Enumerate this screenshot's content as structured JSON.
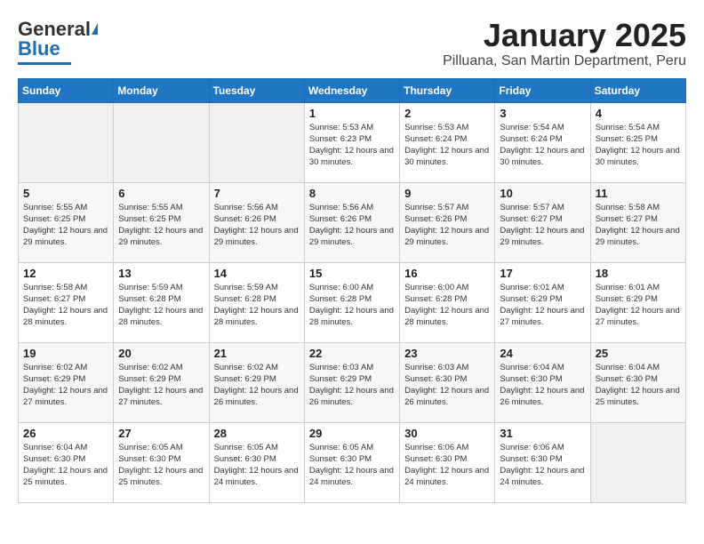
{
  "header": {
    "logo_general": "General",
    "logo_blue": "Blue",
    "title": "January 2025",
    "subtitle": "Pilluana, San Martin Department, Peru"
  },
  "days_of_week": [
    "Sunday",
    "Monday",
    "Tuesday",
    "Wednesday",
    "Thursday",
    "Friday",
    "Saturday"
  ],
  "weeks": [
    [
      {
        "day": "",
        "sunrise": "",
        "sunset": "",
        "daylight": ""
      },
      {
        "day": "",
        "sunrise": "",
        "sunset": "",
        "daylight": ""
      },
      {
        "day": "",
        "sunrise": "",
        "sunset": "",
        "daylight": ""
      },
      {
        "day": "1",
        "sunrise": "Sunrise: 5:53 AM",
        "sunset": "Sunset: 6:23 PM",
        "daylight": "Daylight: 12 hours and 30 minutes."
      },
      {
        "day": "2",
        "sunrise": "Sunrise: 5:53 AM",
        "sunset": "Sunset: 6:24 PM",
        "daylight": "Daylight: 12 hours and 30 minutes."
      },
      {
        "day": "3",
        "sunrise": "Sunrise: 5:54 AM",
        "sunset": "Sunset: 6:24 PM",
        "daylight": "Daylight: 12 hours and 30 minutes."
      },
      {
        "day": "4",
        "sunrise": "Sunrise: 5:54 AM",
        "sunset": "Sunset: 6:25 PM",
        "daylight": "Daylight: 12 hours and 30 minutes."
      }
    ],
    [
      {
        "day": "5",
        "sunrise": "Sunrise: 5:55 AM",
        "sunset": "Sunset: 6:25 PM",
        "daylight": "Daylight: 12 hours and 29 minutes."
      },
      {
        "day": "6",
        "sunrise": "Sunrise: 5:55 AM",
        "sunset": "Sunset: 6:25 PM",
        "daylight": "Daylight: 12 hours and 29 minutes."
      },
      {
        "day": "7",
        "sunrise": "Sunrise: 5:56 AM",
        "sunset": "Sunset: 6:26 PM",
        "daylight": "Daylight: 12 hours and 29 minutes."
      },
      {
        "day": "8",
        "sunrise": "Sunrise: 5:56 AM",
        "sunset": "Sunset: 6:26 PM",
        "daylight": "Daylight: 12 hours and 29 minutes."
      },
      {
        "day": "9",
        "sunrise": "Sunrise: 5:57 AM",
        "sunset": "Sunset: 6:26 PM",
        "daylight": "Daylight: 12 hours and 29 minutes."
      },
      {
        "day": "10",
        "sunrise": "Sunrise: 5:57 AM",
        "sunset": "Sunset: 6:27 PM",
        "daylight": "Daylight: 12 hours and 29 minutes."
      },
      {
        "day": "11",
        "sunrise": "Sunrise: 5:58 AM",
        "sunset": "Sunset: 6:27 PM",
        "daylight": "Daylight: 12 hours and 29 minutes."
      }
    ],
    [
      {
        "day": "12",
        "sunrise": "Sunrise: 5:58 AM",
        "sunset": "Sunset: 6:27 PM",
        "daylight": "Daylight: 12 hours and 28 minutes."
      },
      {
        "day": "13",
        "sunrise": "Sunrise: 5:59 AM",
        "sunset": "Sunset: 6:28 PM",
        "daylight": "Daylight: 12 hours and 28 minutes."
      },
      {
        "day": "14",
        "sunrise": "Sunrise: 5:59 AM",
        "sunset": "Sunset: 6:28 PM",
        "daylight": "Daylight: 12 hours and 28 minutes."
      },
      {
        "day": "15",
        "sunrise": "Sunrise: 6:00 AM",
        "sunset": "Sunset: 6:28 PM",
        "daylight": "Daylight: 12 hours and 28 minutes."
      },
      {
        "day": "16",
        "sunrise": "Sunrise: 6:00 AM",
        "sunset": "Sunset: 6:28 PM",
        "daylight": "Daylight: 12 hours and 28 minutes."
      },
      {
        "day": "17",
        "sunrise": "Sunrise: 6:01 AM",
        "sunset": "Sunset: 6:29 PM",
        "daylight": "Daylight: 12 hours and 27 minutes."
      },
      {
        "day": "18",
        "sunrise": "Sunrise: 6:01 AM",
        "sunset": "Sunset: 6:29 PM",
        "daylight": "Daylight: 12 hours and 27 minutes."
      }
    ],
    [
      {
        "day": "19",
        "sunrise": "Sunrise: 6:02 AM",
        "sunset": "Sunset: 6:29 PM",
        "daylight": "Daylight: 12 hours and 27 minutes."
      },
      {
        "day": "20",
        "sunrise": "Sunrise: 6:02 AM",
        "sunset": "Sunset: 6:29 PM",
        "daylight": "Daylight: 12 hours and 27 minutes."
      },
      {
        "day": "21",
        "sunrise": "Sunrise: 6:02 AM",
        "sunset": "Sunset: 6:29 PM",
        "daylight": "Daylight: 12 hours and 26 minutes."
      },
      {
        "day": "22",
        "sunrise": "Sunrise: 6:03 AM",
        "sunset": "Sunset: 6:29 PM",
        "daylight": "Daylight: 12 hours and 26 minutes."
      },
      {
        "day": "23",
        "sunrise": "Sunrise: 6:03 AM",
        "sunset": "Sunset: 6:30 PM",
        "daylight": "Daylight: 12 hours and 26 minutes."
      },
      {
        "day": "24",
        "sunrise": "Sunrise: 6:04 AM",
        "sunset": "Sunset: 6:30 PM",
        "daylight": "Daylight: 12 hours and 26 minutes."
      },
      {
        "day": "25",
        "sunrise": "Sunrise: 6:04 AM",
        "sunset": "Sunset: 6:30 PM",
        "daylight": "Daylight: 12 hours and 25 minutes."
      }
    ],
    [
      {
        "day": "26",
        "sunrise": "Sunrise: 6:04 AM",
        "sunset": "Sunset: 6:30 PM",
        "daylight": "Daylight: 12 hours and 25 minutes."
      },
      {
        "day": "27",
        "sunrise": "Sunrise: 6:05 AM",
        "sunset": "Sunset: 6:30 PM",
        "daylight": "Daylight: 12 hours and 25 minutes."
      },
      {
        "day": "28",
        "sunrise": "Sunrise: 6:05 AM",
        "sunset": "Sunset: 6:30 PM",
        "daylight": "Daylight: 12 hours and 24 minutes."
      },
      {
        "day": "29",
        "sunrise": "Sunrise: 6:05 AM",
        "sunset": "Sunset: 6:30 PM",
        "daylight": "Daylight: 12 hours and 24 minutes."
      },
      {
        "day": "30",
        "sunrise": "Sunrise: 6:06 AM",
        "sunset": "Sunset: 6:30 PM",
        "daylight": "Daylight: 12 hours and 24 minutes."
      },
      {
        "day": "31",
        "sunrise": "Sunrise: 6:06 AM",
        "sunset": "Sunset: 6:30 PM",
        "daylight": "Daylight: 12 hours and 24 minutes."
      },
      {
        "day": "",
        "sunrise": "",
        "sunset": "",
        "daylight": ""
      }
    ]
  ]
}
